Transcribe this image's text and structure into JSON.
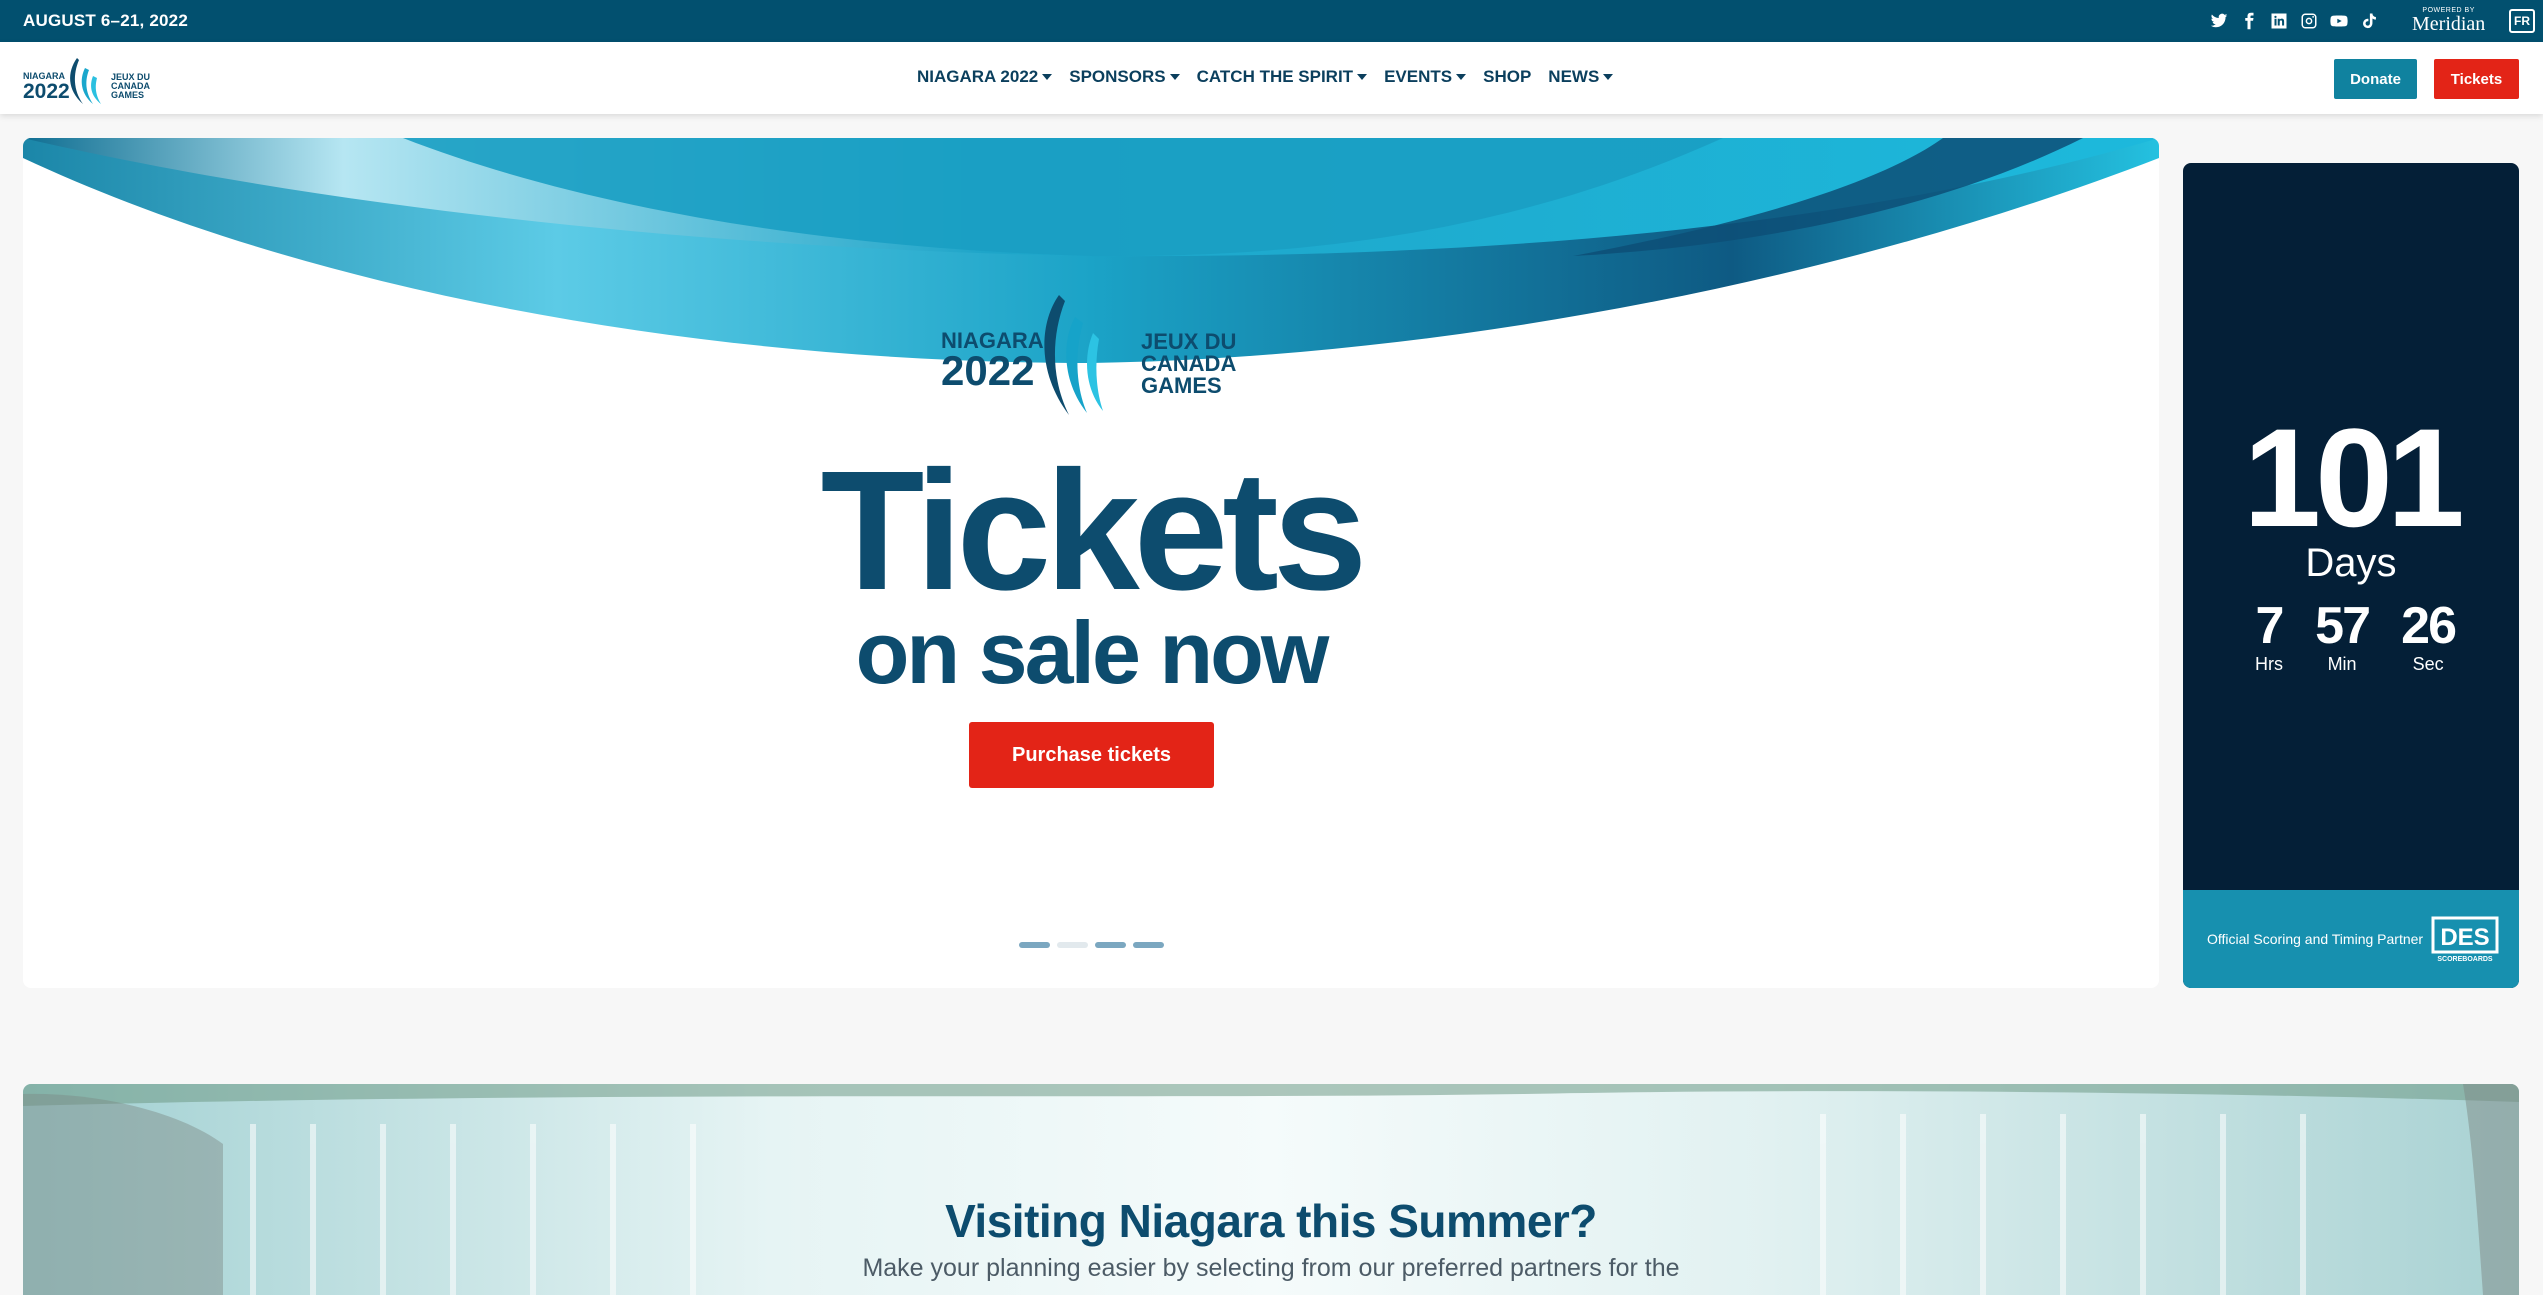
{
  "topbar": {
    "date": "AUGUST 6–21, 2022",
    "socials": [
      "twitter-icon",
      "facebook-icon",
      "linkedin-icon",
      "instagram-icon",
      "youtube-icon",
      "tiktok-icon"
    ],
    "powered_by": "POWERED BY",
    "sponsor": "Meridian",
    "language": "FR"
  },
  "brand": {
    "line1": "NIAGARA",
    "line2": "2022",
    "line3": "JEUX DU",
    "line4": "CANADA",
    "line5": "GAMES"
  },
  "nav": {
    "items": [
      {
        "label": "NIAGARA 2022",
        "dropdown": true
      },
      {
        "label": "SPONSORS",
        "dropdown": true
      },
      {
        "label": "CATCH THE SPIRIT",
        "dropdown": true
      },
      {
        "label": "EVENTS",
        "dropdown": true
      },
      {
        "label": "SHOP",
        "dropdown": false
      },
      {
        "label": "NEWS",
        "dropdown": true
      }
    ],
    "donate_label": "Donate",
    "tickets_label": "Tickets"
  },
  "hero": {
    "headline": "Tickets",
    "subheadline": "on sale now",
    "cta_label": "Purchase tickets",
    "slides": 4,
    "active_slide": 2
  },
  "countdown": {
    "days": "101",
    "days_label": "Days",
    "hours": "7",
    "hours_label": "Hrs",
    "minutes": "57",
    "minutes_label": "Min",
    "seconds": "26",
    "seconds_label": "Sec",
    "partner_text": "Official Scoring and Timing Partner",
    "partner_logo": "DES",
    "partner_logo_sub": "SCOREBOARDS"
  },
  "visiting": {
    "title": "Visiting Niagara this Summer?",
    "body": "Make your planning easier by selecting from our preferred partners for the"
  },
  "colors": {
    "topbar": "#02506f",
    "navy": "#0d4c6e",
    "accent_red": "#e32417",
    "accent_teal": "#10829f",
    "countdown_bg": "#041f37"
  }
}
